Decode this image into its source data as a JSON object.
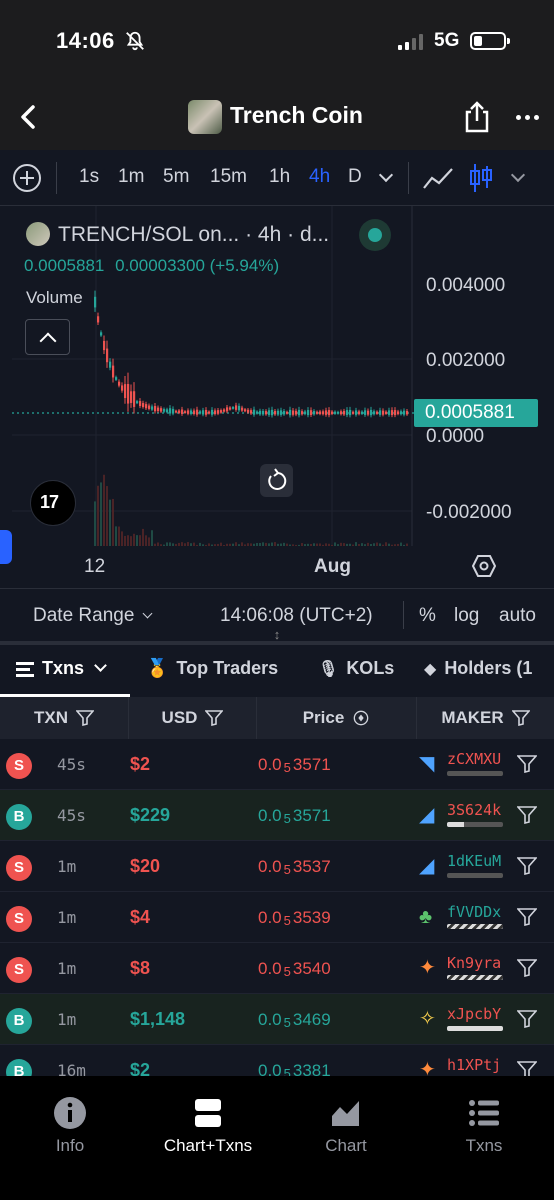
{
  "status_bar": {
    "time": "14:06",
    "network": "5G",
    "battery_percent": 30
  },
  "header": {
    "title": "Trench Coin"
  },
  "chart_toolbar": {
    "timeframes": [
      "1s",
      "1m",
      "5m",
      "15m",
      "1h",
      "4h",
      "D"
    ],
    "active_timeframe": "4h"
  },
  "chart": {
    "pair_title": "TRENCH/SOL on... · 4h · d...",
    "last_price": "0.0005881",
    "change": "0.00003300 (+5.94%)",
    "volume_label": "Volume",
    "y_ticks": [
      "0.004000",
      "0.002000",
      "0.0000",
      "-0.002000"
    ],
    "price_tag": "0.0005881",
    "x_labels": [
      "12",
      "Aug"
    ],
    "tv_logo": "17",
    "accent_up": "#26a69a",
    "accent_down": "#ef5350"
  },
  "range_bar": {
    "date_range": "Date Range",
    "clock": "14:06:08 (UTC+2)",
    "percent": "%",
    "log": "log",
    "auto": "auto"
  },
  "tabs": [
    {
      "label": "Txns",
      "active": true
    },
    {
      "label": "Top Traders",
      "active": false
    },
    {
      "label": "KOLs",
      "active": false
    },
    {
      "label": "Holders (1",
      "active": false
    }
  ],
  "table": {
    "headers": {
      "txn": "TXN",
      "usd": "USD",
      "price": "Price",
      "maker": "MAKER"
    },
    "rows": [
      {
        "side": "S",
        "age": "45s",
        "usd": "$2",
        "price_prefix": "0.0",
        "price_zeros": "5",
        "price_digits": "3571",
        "maker": "zCXMXU",
        "maker_color": "#ef5350",
        "icon": "wave-icon",
        "bar": 0
      },
      {
        "side": "B",
        "age": "45s",
        "usd": "$229",
        "price_prefix": "0.0",
        "price_zeros": "5",
        "price_digits": "3571",
        "maker": "3S624k",
        "maker_color": "#ef5350",
        "icon": "dolphin-icon",
        "bar": 0.3
      },
      {
        "side": "S",
        "age": "1m",
        "usd": "$20",
        "price_prefix": "0.0",
        "price_zeros": "5",
        "price_digits": "3537",
        "maker": "1dKEuM",
        "maker_color": "#26a69a",
        "icon": "dolphin-icon",
        "bar": 0
      },
      {
        "side": "S",
        "age": "1m",
        "usd": "$4",
        "price_prefix": "0.0",
        "price_zeros": "5",
        "price_digits": "3539",
        "maker": "fVVDDx",
        "maker_color": "#26a69a",
        "icon": "frog-icon",
        "bar": -1
      },
      {
        "side": "S",
        "age": "1m",
        "usd": "$8",
        "price_prefix": "0.0",
        "price_zeros": "5",
        "price_digits": "3540",
        "maker": "Kn9yra",
        "maker_color": "#ef5350",
        "icon": "shrimp-icon",
        "bar": -1
      },
      {
        "side": "B",
        "age": "1m",
        "usd": "$1,148",
        "price_prefix": "0.0",
        "price_zeros": "5",
        "price_digits": "3469",
        "maker": "xJpcbY",
        "maker_color": "#ef5350",
        "icon": "sparkle-dolphin-icon",
        "bar": 1
      },
      {
        "side": "B",
        "age": "16m",
        "usd": "$2",
        "price_prefix": "0.0",
        "price_zeros": "5",
        "price_digits": "3381",
        "maker": "h1XPtj",
        "maker_color": "#ef5350",
        "icon": "shrimp-icon",
        "bar": 0
      }
    ]
  },
  "bottom_nav": [
    {
      "label": "Info",
      "icon": "info-icon",
      "active": false
    },
    {
      "label": "Chart+Txns",
      "icon": "split-view-icon",
      "active": true
    },
    {
      "label": "Chart",
      "icon": "area-chart-icon",
      "active": false
    },
    {
      "label": "Txns",
      "icon": "list-icon",
      "active": false
    }
  ]
}
